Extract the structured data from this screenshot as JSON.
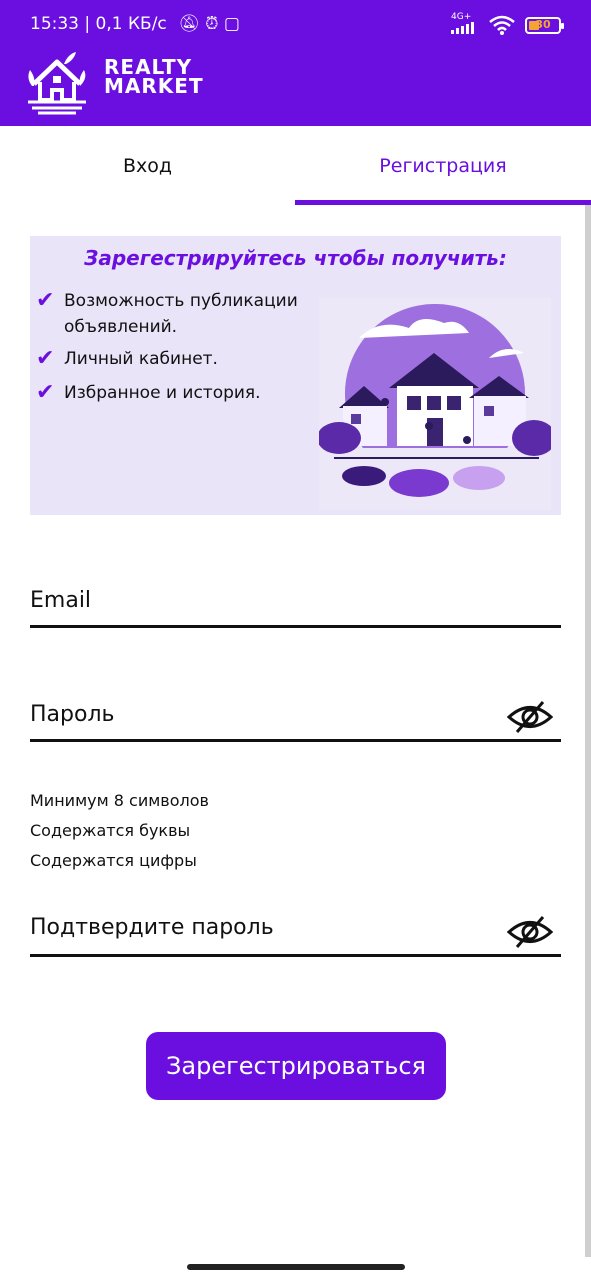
{
  "status_bar": {
    "time": "15:33",
    "net_speed": "| 0,1 КБ/с",
    "net_type": "4G+",
    "battery": "30"
  },
  "app": {
    "logo_line1": "REALTY",
    "logo_line2": "MARKET",
    "brand_color": "#6a0fe0"
  },
  "tabs": {
    "login": "Вход",
    "register": "Регистрация",
    "active": "register"
  },
  "promo": {
    "title": "Зарегестрируйтесь чтобы получить:",
    "benefits": [
      "Возможность публикации объявлений.",
      "Личный кабинет.",
      "Избранное и история."
    ]
  },
  "form": {
    "email_label": "Email",
    "password_label": "Пароль",
    "requirements": [
      "Минимум 8 символов",
      "Содержатся буквы",
      "Содержатся цифры"
    ],
    "confirm_label": "Подтвердите пароль",
    "submit": "Зарегестрироваться"
  }
}
